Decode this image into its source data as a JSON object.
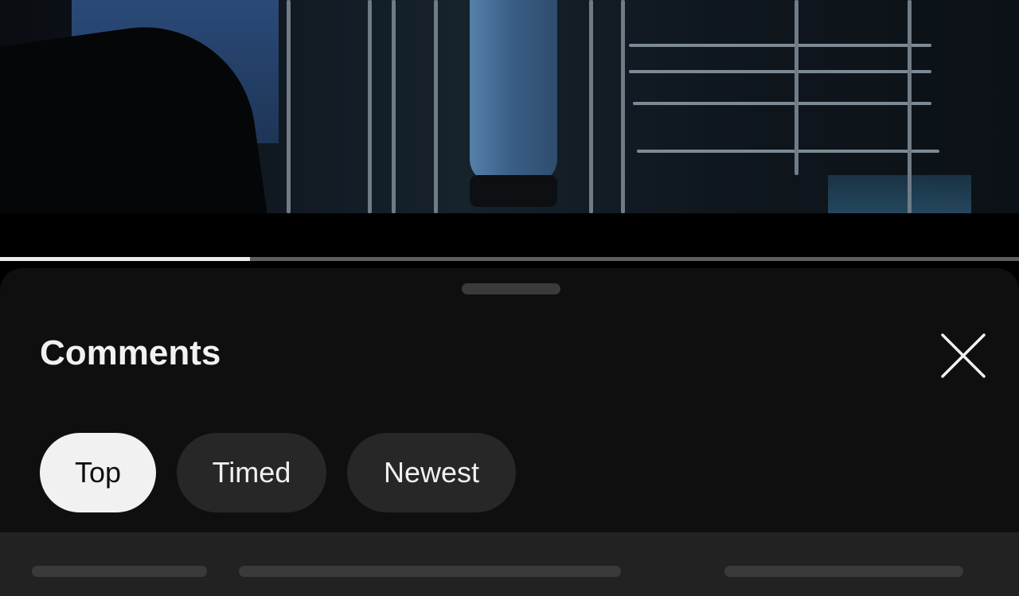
{
  "video": {
    "progress_fraction": 0.245
  },
  "comments_panel": {
    "title": "Comments",
    "close_icon": "close-icon",
    "filters": [
      {
        "label": "Top",
        "selected": true
      },
      {
        "label": "Timed",
        "selected": false
      },
      {
        "label": "Newest",
        "selected": false
      }
    ]
  },
  "colors": {
    "sheet_background": "#0f0f0f",
    "chip_background": "#272727",
    "chip_selected_background": "#f1f1f1",
    "progress_played": "#ececec",
    "progress_track": "#5f5f5f"
  }
}
